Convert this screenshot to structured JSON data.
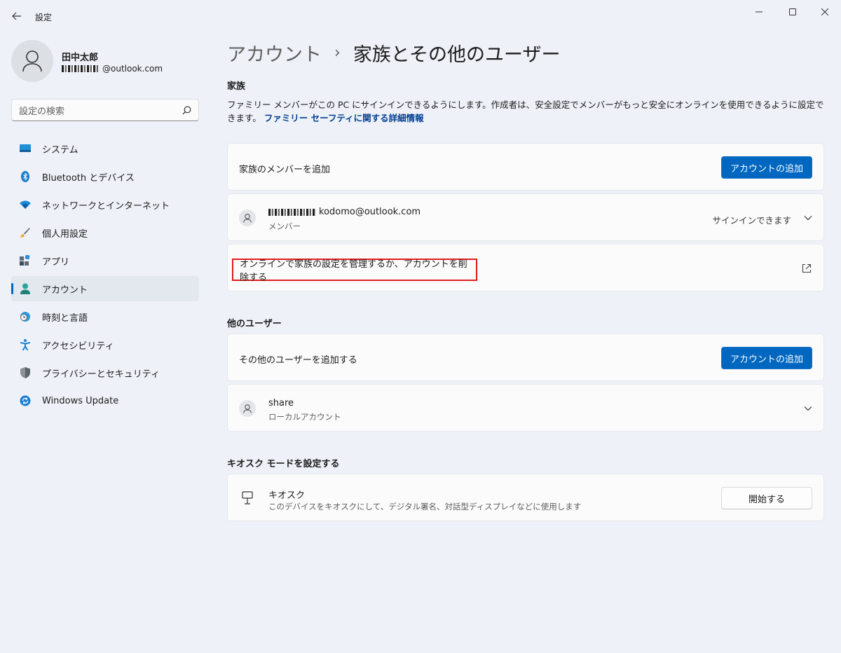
{
  "window": {
    "title": "設定"
  },
  "profile": {
    "name": "田中太郎",
    "email_suffix": "@outlook.com"
  },
  "search": {
    "placeholder": "設定の検索"
  },
  "sidebar": {
    "items": [
      {
        "label": "システム",
        "icon": "system-icon"
      },
      {
        "label": "Bluetooth とデバイス",
        "icon": "bluetooth-icon"
      },
      {
        "label": "ネットワークとインターネット",
        "icon": "wifi-icon"
      },
      {
        "label": "個人用設定",
        "icon": "brush-icon"
      },
      {
        "label": "アプリ",
        "icon": "apps-icon"
      },
      {
        "label": "アカウント",
        "icon": "account-icon",
        "active": true
      },
      {
        "label": "時刻と言語",
        "icon": "clock-globe-icon"
      },
      {
        "label": "アクセシビリティ",
        "icon": "accessibility-icon"
      },
      {
        "label": "プライバシーとセキュリティ",
        "icon": "shield-icon"
      },
      {
        "label": "Windows Update",
        "icon": "update-icon"
      }
    ]
  },
  "breadcrumb": {
    "parent": "アカウント",
    "separator": "›",
    "current": "家族とその他のユーザー"
  },
  "family": {
    "heading": "家族",
    "description": "ファミリー メンバーがこの PC にサインインできるようにします。作成者は、安全設定でメンバーがもっと安全にオンラインを使用できるように設定できます。",
    "link": "ファミリー セーフティに関する詳細情報",
    "add_label": "家族のメンバーを追加",
    "add_button": "アカウントの追加",
    "member": {
      "email_suffix": "kodomo@outlook.com",
      "role": "メンバー",
      "status": "サインインできます"
    },
    "manage_label": "オンラインで家族の設定を管理するか、アカウントを削除する"
  },
  "other_users": {
    "heading": "他のユーザー",
    "add_label": "その他のユーザーを追加する",
    "add_button": "アカウントの追加",
    "user": {
      "name": "share",
      "type": "ローカルアカウント"
    }
  },
  "kiosk": {
    "heading": "キオスク モードを設定する",
    "title": "キオスク",
    "description": "このデバイスをキオスクにして、デジタル署名、対話型ディスプレイなどに使用します",
    "button": "開始する"
  },
  "colors": {
    "accent": "#0067c0",
    "highlight": "#e01c1c"
  }
}
